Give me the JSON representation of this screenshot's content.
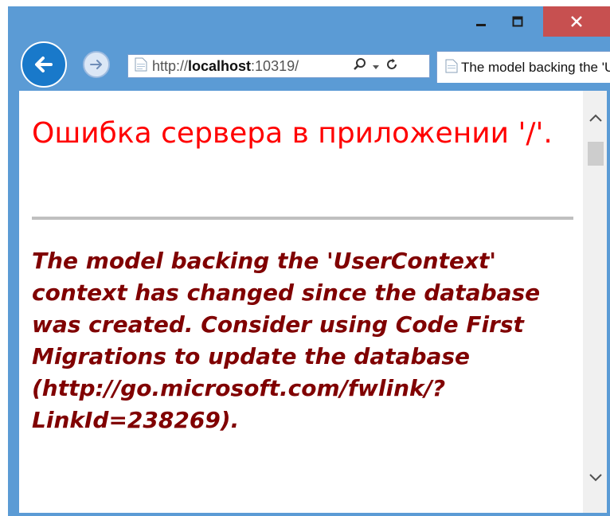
{
  "browser": {
    "address": {
      "url_prefix": "http://",
      "url_host": "localhost",
      "url_rest": ":10319/"
    },
    "tab": {
      "title": "The model backing the 'UserContext' context has changed"
    },
    "icons": {
      "back": "back-arrow-icon",
      "forward": "forward-arrow-icon",
      "search": "search-icon",
      "dropdown": "dropdown-icon",
      "refresh": "refresh-icon",
      "page": "page-icon",
      "minimize": "minimize-icon",
      "maximize": "maximize-icon",
      "close": "close-icon"
    }
  },
  "page": {
    "title": "Ошибка сервера в приложении '/'.",
    "message": "The model backing the 'UserContext' context has changed since the database was created. Consider using Code First Migrations to update the database (http://go.microsoft.com/fwlink/?LinkId=238269)."
  },
  "colors": {
    "window_frame": "#5b9bd5",
    "close_button": "#c75050",
    "title_red": "#ff0000",
    "message_maroon": "#800000",
    "rule_gray": "#c0c0c0"
  }
}
